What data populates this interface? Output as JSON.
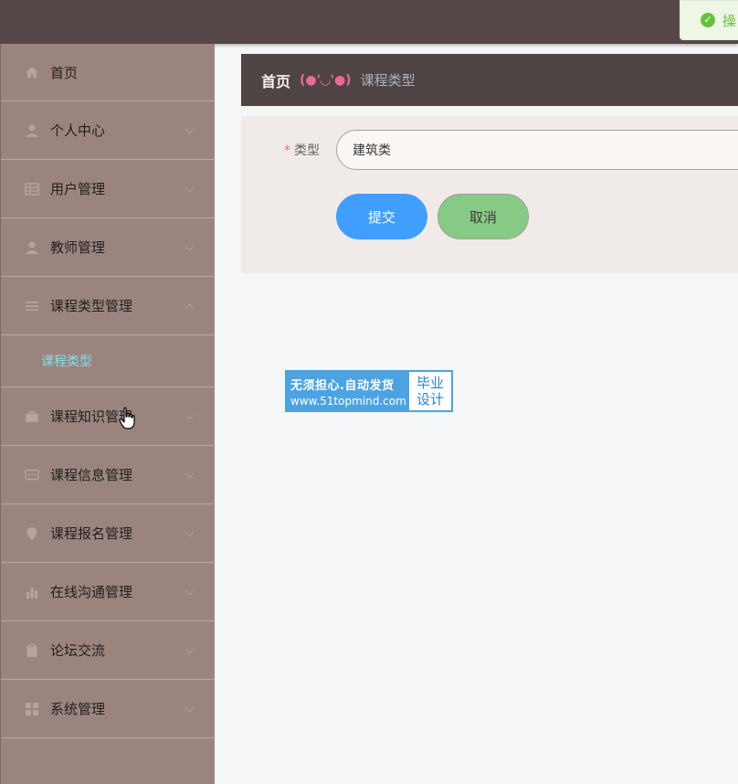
{
  "toast": {
    "text": "操"
  },
  "sidebar": {
    "items": [
      {
        "label": "首页",
        "icon": "home-icon"
      },
      {
        "label": "个人中心",
        "icon": "user-icon"
      },
      {
        "label": "用户管理",
        "icon": "grid-icon"
      },
      {
        "label": "教师管理",
        "icon": "teacher-icon"
      },
      {
        "label": "课程类型管理",
        "icon": "list-icon",
        "expanded": true,
        "children": [
          {
            "label": "课程类型"
          }
        ]
      },
      {
        "label": "课程知识管理",
        "icon": "briefcase-icon"
      },
      {
        "label": "课程信息管理",
        "icon": "message-icon"
      },
      {
        "label": "课程报名管理",
        "icon": "location-icon"
      },
      {
        "label": "在线沟通管理",
        "icon": "bar-chart-icon"
      },
      {
        "label": "论坛交流",
        "icon": "clipboard-icon"
      },
      {
        "label": "系统管理",
        "icon": "apps-icon"
      }
    ]
  },
  "breadcrumb": {
    "home": "首页",
    "separator": "(●'◡'●)",
    "current": "课程类型"
  },
  "form": {
    "type_label": "类型",
    "required_mark": "*",
    "type_value": "建筑类",
    "submit_label": "提交",
    "cancel_label": "取消"
  },
  "watermark": {
    "line1": "无须担心.自动发货",
    "line2": "www.51topmind.com",
    "right1": "毕业",
    "right2": "设计"
  },
  "colors": {
    "topbar": "#554747",
    "sidebar": "#9c847e",
    "active_submenu": "#7de0f0",
    "submit": "#409eff",
    "cancel": "#86ca86"
  }
}
